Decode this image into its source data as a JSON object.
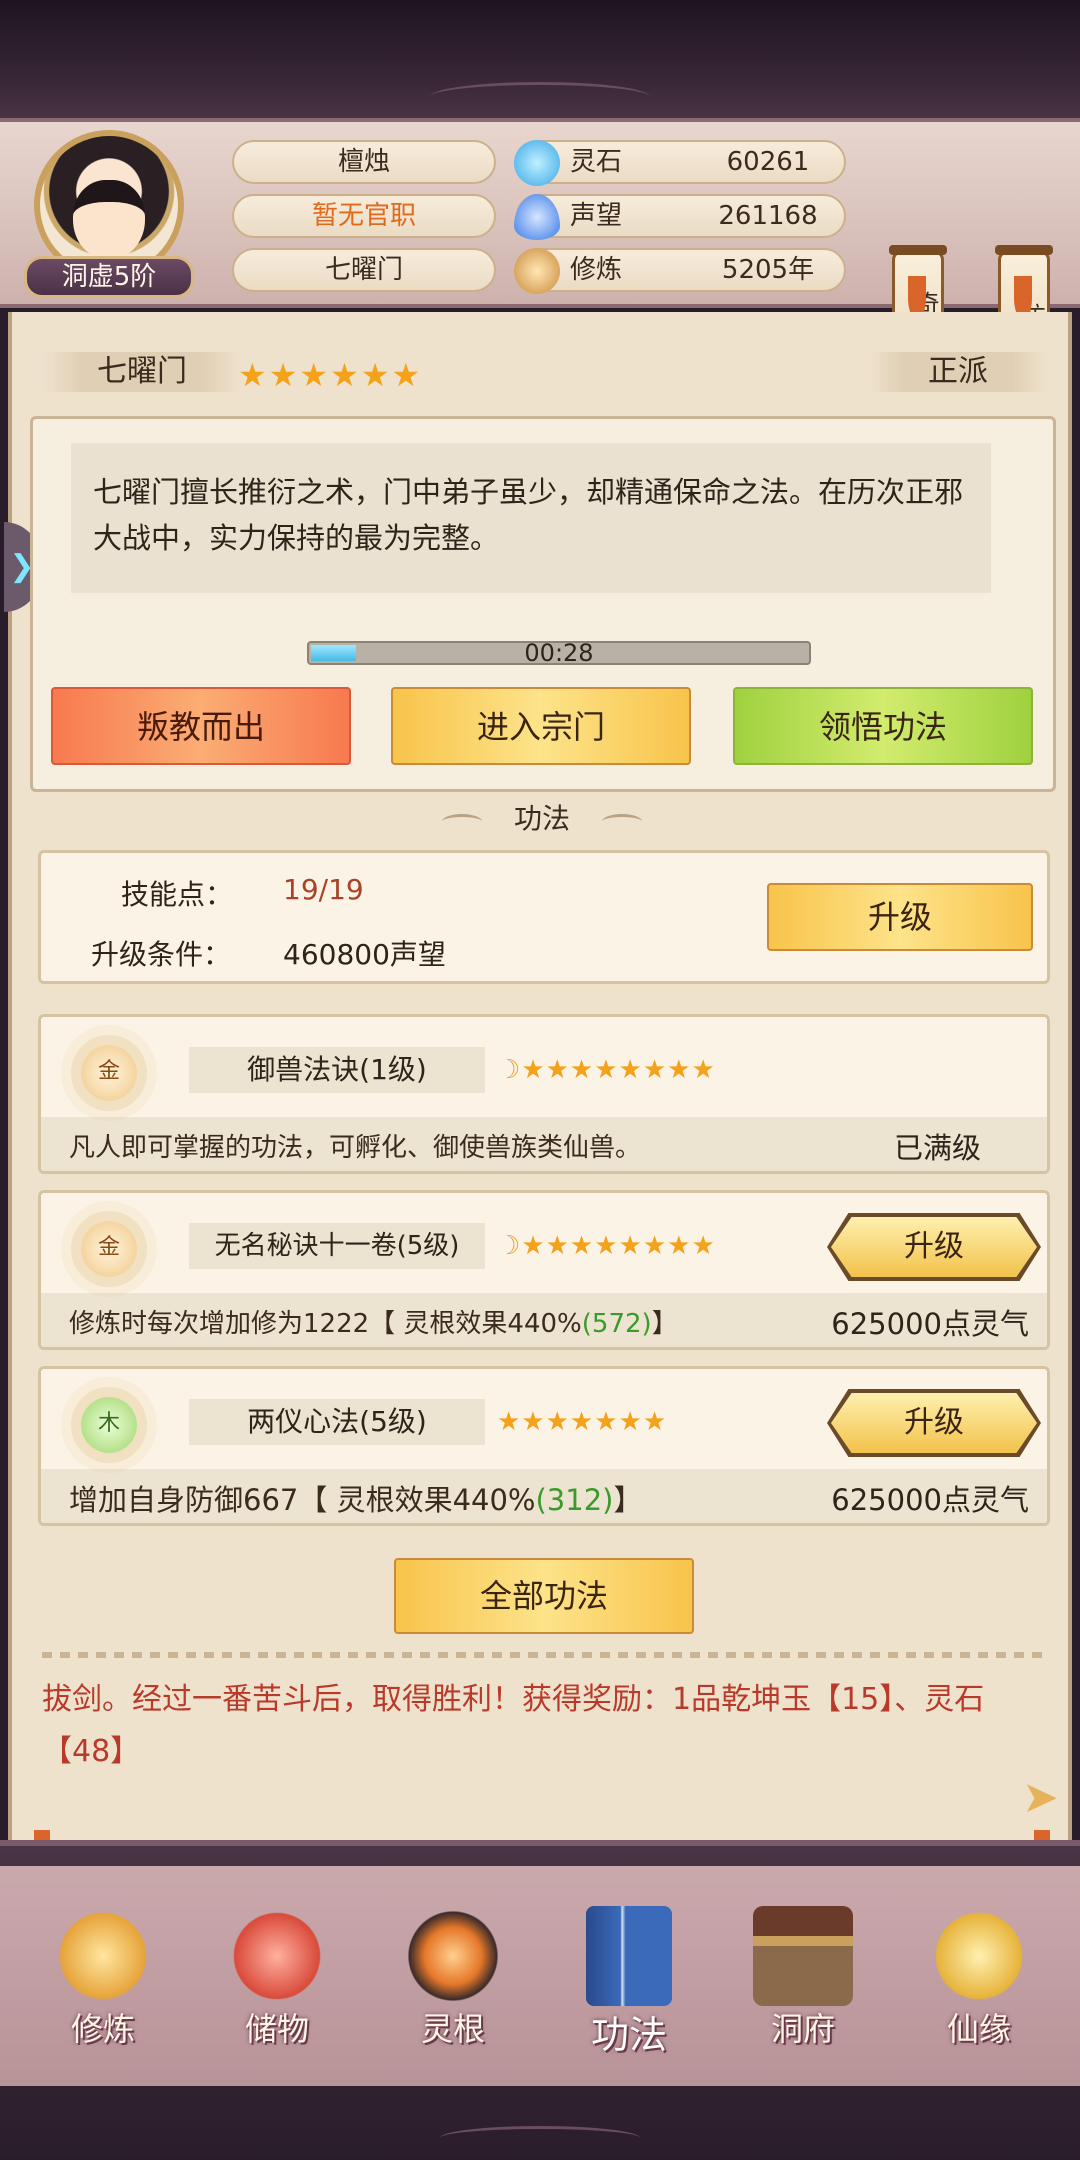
{
  "header": {
    "realm_badge": "洞虚5阶",
    "player_name": "檀烛",
    "official_title": "暂无官职",
    "sect_name": "七曜门",
    "resources": [
      {
        "label": "灵石",
        "value": "60261",
        "icon": "spirit-stone-icon",
        "color": "#3aa6e6"
      },
      {
        "label": "声望",
        "value": "261168",
        "icon": "reputation-icon",
        "color": "#3a7ae6"
      },
      {
        "label": "修炼",
        "value": "5205年",
        "icon": "cultivation-icon",
        "color": "#c98a3a"
      }
    ],
    "scroll_buttons": [
      {
        "label": "奇珍会"
      },
      {
        "label": "坊市"
      }
    ]
  },
  "sect": {
    "name": "七曜门",
    "stars": "★★★★★★",
    "star_count": 6,
    "faction": "正派",
    "description": "七曜门擅长推衍之术，门中弟子虽少，却精通保命之法。在历次正邪大战中，实力保持的最为完整。",
    "timer": "00:28",
    "timer_progress": 0.09,
    "buttons": {
      "betray": "叛教而出",
      "enter": "进入宗门",
      "learn": "领悟功法"
    }
  },
  "gongfa": {
    "title": "功法",
    "skill_points_label": "技能点：",
    "skill_points_value": "19/19",
    "upgrade_cond_label": "升级条件：",
    "upgrade_cond_value": "460800声望",
    "upgrade_label": "升级",
    "skills": [
      {
        "element": "金",
        "name": "御兽法诀(1级)",
        "stars": "★★★★★★★★",
        "moon": true,
        "desc_main": "凡人即可掌握的功法，可孵化、御使兽族类仙兽。",
        "desc_green": "",
        "desc_tail": "",
        "status": "已满级"
      },
      {
        "element": "金",
        "name": "无名秘诀十一卷(5级)",
        "stars": "★★★★★★★★",
        "moon": true,
        "desc_main": "修炼时每次增加修为1222【 灵根效果440%",
        "desc_green": "(572)",
        "desc_tail": "】",
        "button": "升级",
        "cost": "625000点灵气"
      },
      {
        "element": "木",
        "name": "两仪心法(5级)",
        "stars": "★★★★★★★",
        "moon": false,
        "desc_main": "增加自身防御667【 灵根效果440%",
        "desc_green": "(312)",
        "desc_tail": "】",
        "button": "升级",
        "cost": "625000点灵气"
      }
    ],
    "all_button": "全部功法"
  },
  "log": {
    "text": "拔剑。经过一番苦斗后，取得胜利！获得奖励：1品乾坤玉【15】、灵石【48】"
  },
  "nav": [
    {
      "label": "修炼",
      "icon": "cultivate-icon",
      "color": "#e6a33a"
    },
    {
      "label": "储物",
      "icon": "storage-bag-icon",
      "color": "#d94a3a"
    },
    {
      "label": "灵根",
      "icon": "spirit-root-icon",
      "color": "#e6782a"
    },
    {
      "label": "功法",
      "icon": "scripture-book-icon",
      "color": "#3a6ab9"
    },
    {
      "label": "洞府",
      "icon": "cave-house-icon",
      "color": "#8a6a4a"
    },
    {
      "label": "仙缘",
      "icon": "gourd-icon",
      "color": "#e6b33a"
    }
  ]
}
